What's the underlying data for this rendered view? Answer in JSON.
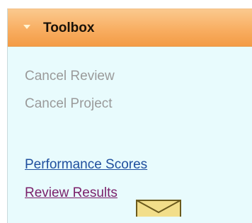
{
  "toolbox": {
    "title": "Toolbox",
    "header_color": "#f8ae62",
    "panel_color": "#e8fbfd",
    "toggle_icon": "chevron-down-icon",
    "items": [
      {
        "label": "Cancel Review",
        "state": "disabled"
      },
      {
        "label": "Cancel Project",
        "state": "disabled"
      },
      {
        "label": "Performance Scores",
        "state": "link"
      },
      {
        "label": "Review Results",
        "state": "visited-link"
      }
    ],
    "bottom_icon": "envelope-icon"
  }
}
